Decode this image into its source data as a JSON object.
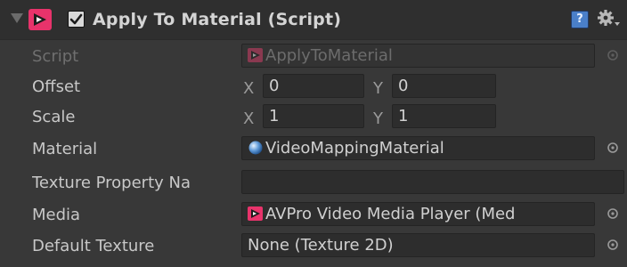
{
  "header": {
    "title": "Apply To Material (Script)",
    "enabled": true,
    "help_label": "?"
  },
  "icons": {
    "foldout": "foldout-triangle-icon",
    "component": "avpro-script-icon",
    "help": "help-book-icon",
    "settings": "gear-icon",
    "material": "sphere-material-icon",
    "object_picker": "object-picker-circle-icon"
  },
  "colors": {
    "accent_pink": "#e8336b",
    "panel_bg": "#383838",
    "field_bg": "#2d2d2d",
    "help_blue": "#4a7fc9"
  },
  "fields": {
    "script": {
      "label": "Script",
      "value": "ApplyToMaterial"
    },
    "offset": {
      "label": "Offset",
      "x_label": "X",
      "x": "0",
      "y_label": "Y",
      "y": "0"
    },
    "scale": {
      "label": "Scale",
      "x_label": "X",
      "x": "1",
      "y_label": "Y",
      "y": "1"
    },
    "material": {
      "label": "Material",
      "value": "VideoMappingMaterial"
    },
    "texture_property": {
      "label": "Texture Property Na",
      "value": ""
    },
    "media": {
      "label": "Media",
      "value": "AVPro Video Media Player (Med"
    },
    "default_texture": {
      "label": "Default Texture",
      "value": "None (Texture 2D)"
    }
  }
}
